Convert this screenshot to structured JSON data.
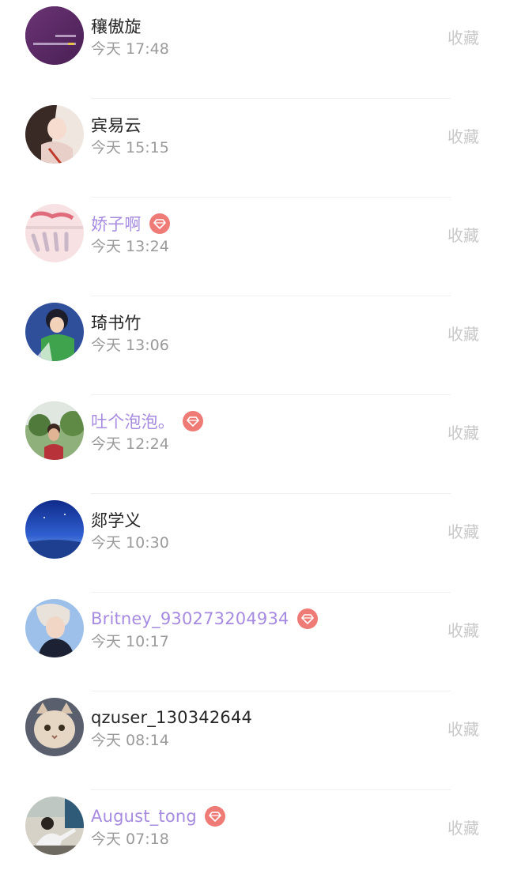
{
  "contacts": [
    {
      "name": "穰傲旋",
      "time": "今天 17:48",
      "vip": false,
      "avatar": "avatar-purple-text",
      "action": "收藏"
    },
    {
      "name": "宾易云",
      "time": "今天 15:15",
      "vip": false,
      "avatar": "avatar-illustrated-girl",
      "action": "收藏"
    },
    {
      "name": "娇子啊",
      "time": "今天 13:24",
      "vip": true,
      "avatar": "avatar-pink-handwriting",
      "action": "收藏"
    },
    {
      "name": "琦书竹",
      "time": "今天 13:06",
      "vip": false,
      "avatar": "avatar-anime-boy",
      "action": "收藏"
    },
    {
      "name": "吐个泡泡。",
      "time": "今天 12:24",
      "vip": true,
      "avatar": "avatar-child-outdoors",
      "action": "收藏"
    },
    {
      "name": "郯学义",
      "time": "今天 10:30",
      "vip": false,
      "avatar": "avatar-blue-sky",
      "action": "收藏"
    },
    {
      "name": "Britney_930273204934",
      "time": "今天 10:17",
      "vip": true,
      "avatar": "avatar-person-portrait",
      "action": "收藏"
    },
    {
      "name": "qzuser_130342644",
      "time": "今天 08:14",
      "vip": false,
      "avatar": "avatar-cat",
      "action": "收藏"
    },
    {
      "name": "August_tong",
      "time": "今天 07:18",
      "vip": true,
      "avatar": "avatar-person-outdoors",
      "action": "收藏"
    }
  ],
  "colors": {
    "vip_name": "#a68be0",
    "normal_name": "#262626",
    "time": "#9a9a9a",
    "action": "#c8c8c8",
    "vip_badge": "#ee7b76"
  }
}
